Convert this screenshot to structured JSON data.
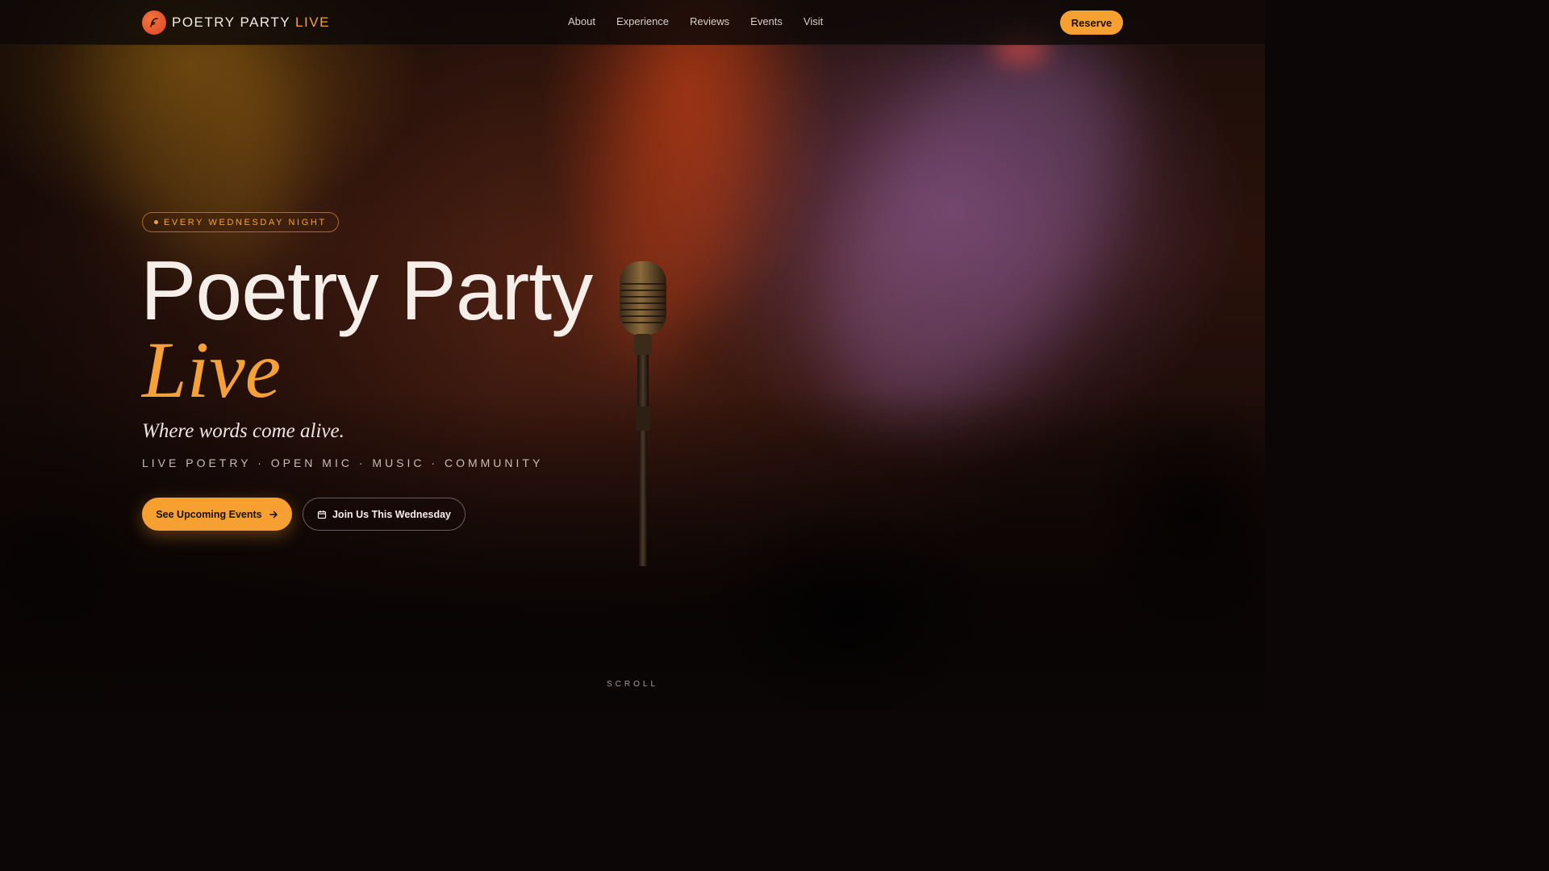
{
  "nav": {
    "brand_main": "POETRY PARTY ",
    "brand_accent": "LIVE",
    "logo_icon": "feather-pen-icon",
    "links": [
      "About",
      "Experience",
      "Reviews",
      "Events",
      "Visit"
    ],
    "reserve_label": "Reserve"
  },
  "hero": {
    "badge": "EVERY WEDNESDAY NIGHT",
    "title_line1": "Poetry Party",
    "title_line2": "Live",
    "tagline": "Where words come alive.",
    "categories": "LIVE POETRY · OPEN MIC · MUSIC · COMMUNITY",
    "primary_button": "See Upcoming Events",
    "primary_button_icon": "arrow-right-icon",
    "secondary_button": "Join Us This Wednesday",
    "secondary_button_icon": "calendar-icon",
    "scroll_label": "SCROLL"
  },
  "colors": {
    "accent": "#f5a13a",
    "button": "#f7a032",
    "text": "#f6efe9",
    "background": "#120907"
  }
}
